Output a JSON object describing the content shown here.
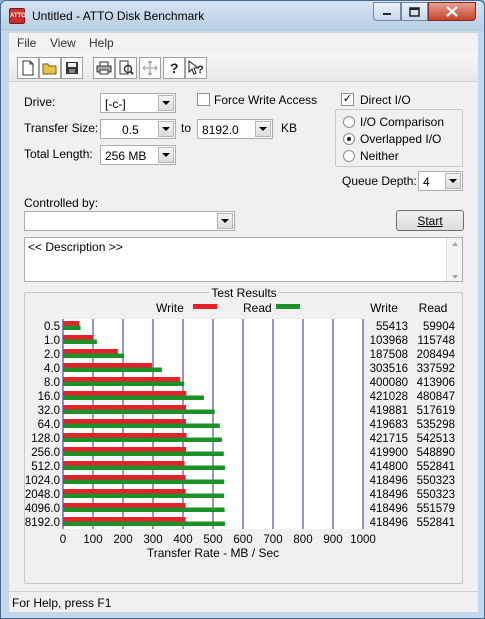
{
  "window": {
    "title": "Untitled - ATTO Disk Benchmark",
    "icon_text": "ATTO"
  },
  "menu": [
    "File",
    "View",
    "Help"
  ],
  "toolbar_icons": [
    "new-file-icon",
    "open-folder-icon",
    "save-icon",
    "print-icon",
    "print-preview-icon",
    "move-icon",
    "help-icon",
    "context-help-icon"
  ],
  "settings": {
    "drive_label": "Drive:",
    "drive_value": "[-c-]",
    "force_write_label": "Force Write Access",
    "force_write_checked": false,
    "direct_io_label": "Direct I/O",
    "direct_io_checked": true,
    "transfer_size_label": "Transfer Size:",
    "transfer_from": "0.5",
    "transfer_to_label": "to",
    "transfer_to": "8192.0",
    "transfer_unit": "KB",
    "total_length_label": "Total Length:",
    "total_length": "256 MB",
    "io_modes": [
      {
        "label": "I/O Comparison",
        "selected": false
      },
      {
        "label": "Overlapped I/O",
        "selected": true
      },
      {
        "label": "Neither",
        "selected": false
      }
    ],
    "queue_depth_label": "Queue Depth:",
    "queue_depth": "4",
    "controlled_by_label": "Controlled by:",
    "controlled_by_value": "",
    "start_label": "Start",
    "description": "<< Description >>"
  },
  "results": {
    "group_title": "Test Results",
    "legend_write": "Write",
    "legend_read": "Read",
    "col_write": "Write",
    "col_read": "Read",
    "xlabel": "Transfer Rate - MB / Sec",
    "colors": {
      "write": "#e8202a",
      "read": "#1b9128",
      "grid": "#2c2c9c"
    }
  },
  "chart_data": {
    "type": "bar",
    "orientation": "horizontal",
    "categories": [
      "0.5",
      "1.0",
      "2.0",
      "4.0",
      "8.0",
      "16.0",
      "32.0",
      "64.0",
      "128.0",
      "256.0",
      "512.0",
      "1024.0",
      "2048.0",
      "4096.0",
      "8192.0"
    ],
    "series": [
      {
        "name": "Write",
        "values": [
          55413,
          103968,
          187508,
          303516,
          400080,
          421028,
          419881,
          419683,
          421715,
          419900,
          414800,
          418496,
          418496,
          418496,
          418496
        ]
      },
      {
        "name": "Read",
        "values": [
          59904,
          115748,
          208494,
          337592,
          413906,
          480847,
          517619,
          535298,
          542513,
          548890,
          552841,
          550323,
          550323,
          551579,
          552841
        ]
      }
    ],
    "xticks": [
      "0",
      "100",
      "200",
      "300",
      "400",
      "500",
      "600",
      "700",
      "800",
      "900",
      "1000"
    ],
    "xlim": [
      0,
      1000
    ],
    "xlabel": "Transfer Rate - MB / Sec",
    "grid": true,
    "legend_position": "top"
  },
  "status": "For Help, press F1"
}
